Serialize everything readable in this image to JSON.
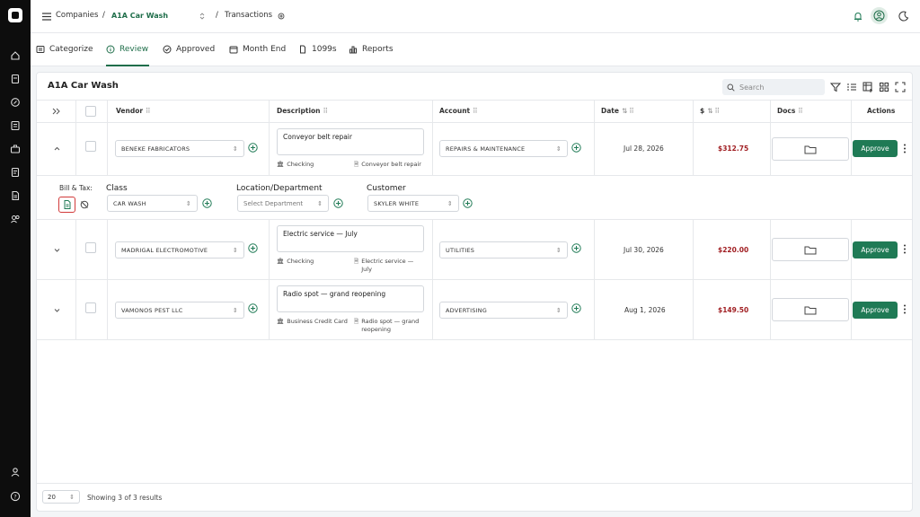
{
  "topbar": {
    "companies": "Companies",
    "sep1": "/",
    "company": "A1A Car Wash",
    "sep2": "/",
    "page": "Transactions"
  },
  "tabs": [
    {
      "label": "Categorize",
      "icon": "categorize-icon"
    },
    {
      "label": "Review",
      "icon": "info-icon",
      "active": true
    },
    {
      "label": "Approved",
      "icon": "check-circle-icon"
    },
    {
      "label": "Month End",
      "icon": "calendar-icon"
    },
    {
      "label": "1099s",
      "icon": "document-icon"
    },
    {
      "label": "Reports",
      "icon": "bar-chart-icon"
    }
  ],
  "card": {
    "title": "A1A Car Wash",
    "search_placeholder": "Search"
  },
  "columns": {
    "vendor": "Vendor",
    "description": "Description",
    "account": "Account",
    "date": "Date",
    "amount": "$",
    "docs": "Docs",
    "actions": "Actions"
  },
  "rows": [
    {
      "vendor": "BENEKE FABRICATORS",
      "description": "Conveyor belt repair",
      "bank": "Checking",
      "memo": "Conveyor belt repair",
      "account": "REPAIRS & MAINTENANCE",
      "date": "Jul 28, 2026",
      "amount": "$312.75",
      "action": "Approve"
    },
    {
      "vendor": "MADRIGAL ELECTROMOTIVE",
      "description": "Electric service — July",
      "bank": "Checking",
      "memo": "Electric service — July",
      "account": "UTILITIES",
      "date": "Jul 30, 2026",
      "amount": "$220.00",
      "action": "Approve"
    },
    {
      "vendor": "VAMONOS PEST LLC",
      "description": "Radio spot — grand reopening",
      "bank": "Business Credit Card",
      "memo": "Radio spot — grand reopening",
      "account": "ADVERTISING",
      "date": "Aug 1, 2026",
      "amount": "$149.50",
      "action": "Approve"
    }
  ],
  "expanded": {
    "bill_tax_label": "Bill & Tax:",
    "class_label": "Class",
    "class_value": "CAR WASH",
    "location_label": "Location/Department",
    "location_placeholder": "Select Department",
    "customer_label": "Customer",
    "customer_value": "SKYLER WHITE"
  },
  "footer": {
    "page_size": "20",
    "showing": "Showing 3 of 3 results"
  },
  "colors": {
    "accent": "#1f7a55",
    "amount": "#a01e22",
    "rail": "#0d0d0d"
  }
}
